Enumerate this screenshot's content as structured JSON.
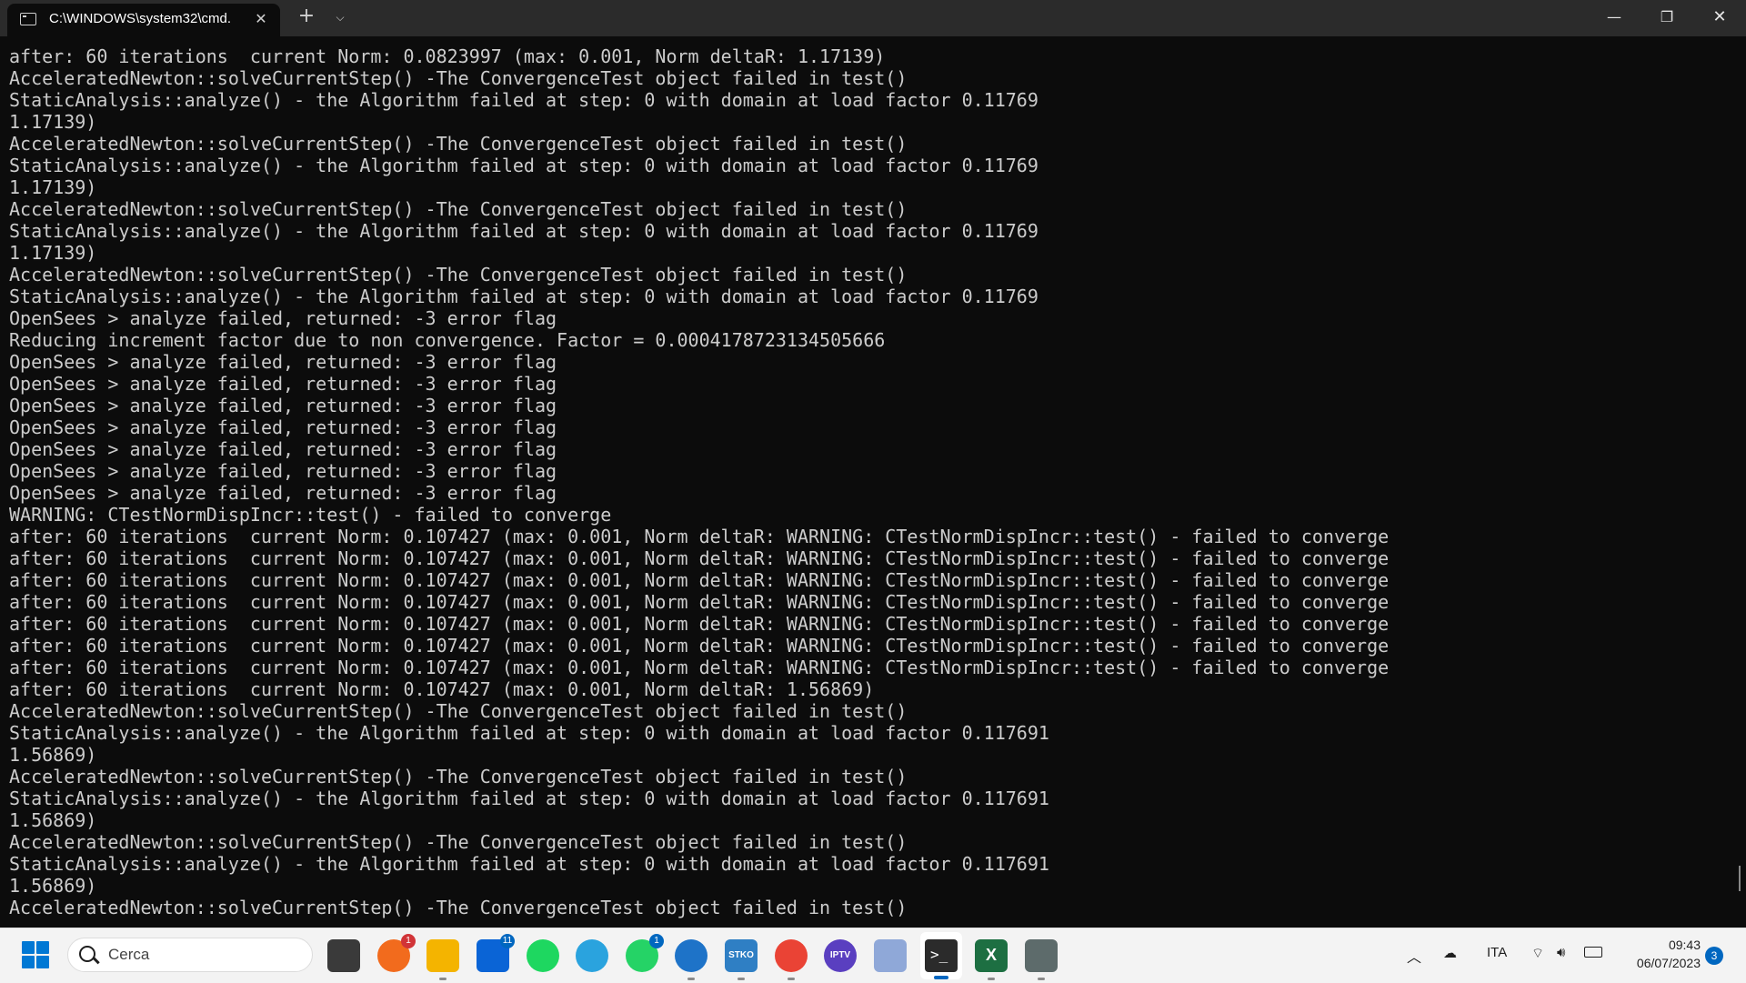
{
  "window": {
    "tab_title": "C:\\WINDOWS\\system32\\cmd.",
    "new_tab_symbol": "+",
    "dropdown_symbol": "⌵",
    "close_tab_symbol": "✕",
    "minimize_symbol": "—",
    "maximize_symbol": "❐",
    "close_symbol": "✕"
  },
  "console": {
    "lines": [
      "after: 60 iterations  current Norm: 0.0823997 (max: 0.001, Norm deltaR: 1.17139)",
      "AcceleratedNewton::solveCurrentStep() -The ConvergenceTest object failed in test()",
      "StaticAnalysis::analyze() - the Algorithm failed at step: 0 with domain at load factor 0.11769",
      "1.17139)",
      "AcceleratedNewton::solveCurrentStep() -The ConvergenceTest object failed in test()",
      "StaticAnalysis::analyze() - the Algorithm failed at step: 0 with domain at load factor 0.11769",
      "1.17139)",
      "AcceleratedNewton::solveCurrentStep() -The ConvergenceTest object failed in test()",
      "StaticAnalysis::analyze() - the Algorithm failed at step: 0 with domain at load factor 0.11769",
      "1.17139)",
      "AcceleratedNewton::solveCurrentStep() -The ConvergenceTest object failed in test()",
      "StaticAnalysis::analyze() - the Algorithm failed at step: 0 with domain at load factor 0.11769",
      "OpenSees > analyze failed, returned: -3 error flag",
      "Reducing increment factor due to non convergence. Factor = 0.0004178723134505666",
      "OpenSees > analyze failed, returned: -3 error flag",
      "OpenSees > analyze failed, returned: -3 error flag",
      "OpenSees > analyze failed, returned: -3 error flag",
      "OpenSees > analyze failed, returned: -3 error flag",
      "OpenSees > analyze failed, returned: -3 error flag",
      "OpenSees > analyze failed, returned: -3 error flag",
      "OpenSees > analyze failed, returned: -3 error flag",
      "WARNING: CTestNormDispIncr::test() - failed to converge",
      "after: 60 iterations  current Norm: 0.107427 (max: 0.001, Norm deltaR: WARNING: CTestNormDispIncr::test() - failed to converge",
      "after: 60 iterations  current Norm: 0.107427 (max: 0.001, Norm deltaR: WARNING: CTestNormDispIncr::test() - failed to converge",
      "after: 60 iterations  current Norm: 0.107427 (max: 0.001, Norm deltaR: WARNING: CTestNormDispIncr::test() - failed to converge",
      "after: 60 iterations  current Norm: 0.107427 (max: 0.001, Norm deltaR: WARNING: CTestNormDispIncr::test() - failed to converge",
      "after: 60 iterations  current Norm: 0.107427 (max: 0.001, Norm deltaR: WARNING: CTestNormDispIncr::test() - failed to converge",
      "after: 60 iterations  current Norm: 0.107427 (max: 0.001, Norm deltaR: WARNING: CTestNormDispIncr::test() - failed to converge",
      "after: 60 iterations  current Norm: 0.107427 (max: 0.001, Norm deltaR: WARNING: CTestNormDispIncr::test() - failed to converge",
      "after: 60 iterations  current Norm: 0.107427 (max: 0.001, Norm deltaR: 1.56869)",
      "AcceleratedNewton::solveCurrentStep() -The ConvergenceTest object failed in test()",
      "StaticAnalysis::analyze() - the Algorithm failed at step: 0 with domain at load factor 0.117691",
      "1.56869)",
      "AcceleratedNewton::solveCurrentStep() -The ConvergenceTest object failed in test()",
      "StaticAnalysis::analyze() - the Algorithm failed at step: 0 with domain at load factor 0.117691",
      "1.56869)",
      "AcceleratedNewton::solveCurrentStep() -The ConvergenceTest object failed in test()",
      "StaticAnalysis::analyze() - the Algorithm failed at step: 0 with domain at load factor 0.117691",
      "1.56869)",
      "AcceleratedNewton::solveCurrentStep() -The ConvergenceTest object failed in test()"
    ]
  },
  "taskbar": {
    "search_placeholder": "Cerca",
    "apps": [
      {
        "name": "task-view",
        "color": "#3a3a3a",
        "badge": ""
      },
      {
        "name": "brave-browser",
        "color": "#f26b1d",
        "badge": "1",
        "badge_color": "#d13438"
      },
      {
        "name": "file-explorer",
        "color": "#f4b400",
        "badge": ""
      },
      {
        "name": "mail",
        "color": "#0a64d6",
        "badge": "11",
        "badge_color": "#0067c0"
      },
      {
        "name": "spotify",
        "color": "#1ed760",
        "badge": ""
      },
      {
        "name": "telegram",
        "color": "#2aa3de",
        "badge": ""
      },
      {
        "name": "whatsapp",
        "color": "#25d366",
        "badge": "1",
        "badge_color": "#0067c0"
      },
      {
        "name": "sync-app",
        "color": "#1e73c8",
        "badge": ""
      },
      {
        "name": "stko",
        "color": "#2f7fc4",
        "badge": "",
        "label": "STKO"
      },
      {
        "name": "chrome",
        "color": "#ea4335",
        "badge": ""
      },
      {
        "name": "iptv",
        "color": "#5a3fc0",
        "badge": "",
        "label": "IPTV"
      },
      {
        "name": "messenger",
        "color": "#8fa8d8",
        "badge": ""
      },
      {
        "name": "terminal",
        "color": "#2b2b2b",
        "badge": ""
      },
      {
        "name": "excel",
        "color": "#1d6f42",
        "badge": "",
        "label": "X"
      },
      {
        "name": "generic-window",
        "color": "#5d6b6b",
        "badge": ""
      }
    ],
    "tray": {
      "language": "ITA",
      "time": "09:43",
      "date": "06/07/2023",
      "notifications": "3"
    }
  }
}
